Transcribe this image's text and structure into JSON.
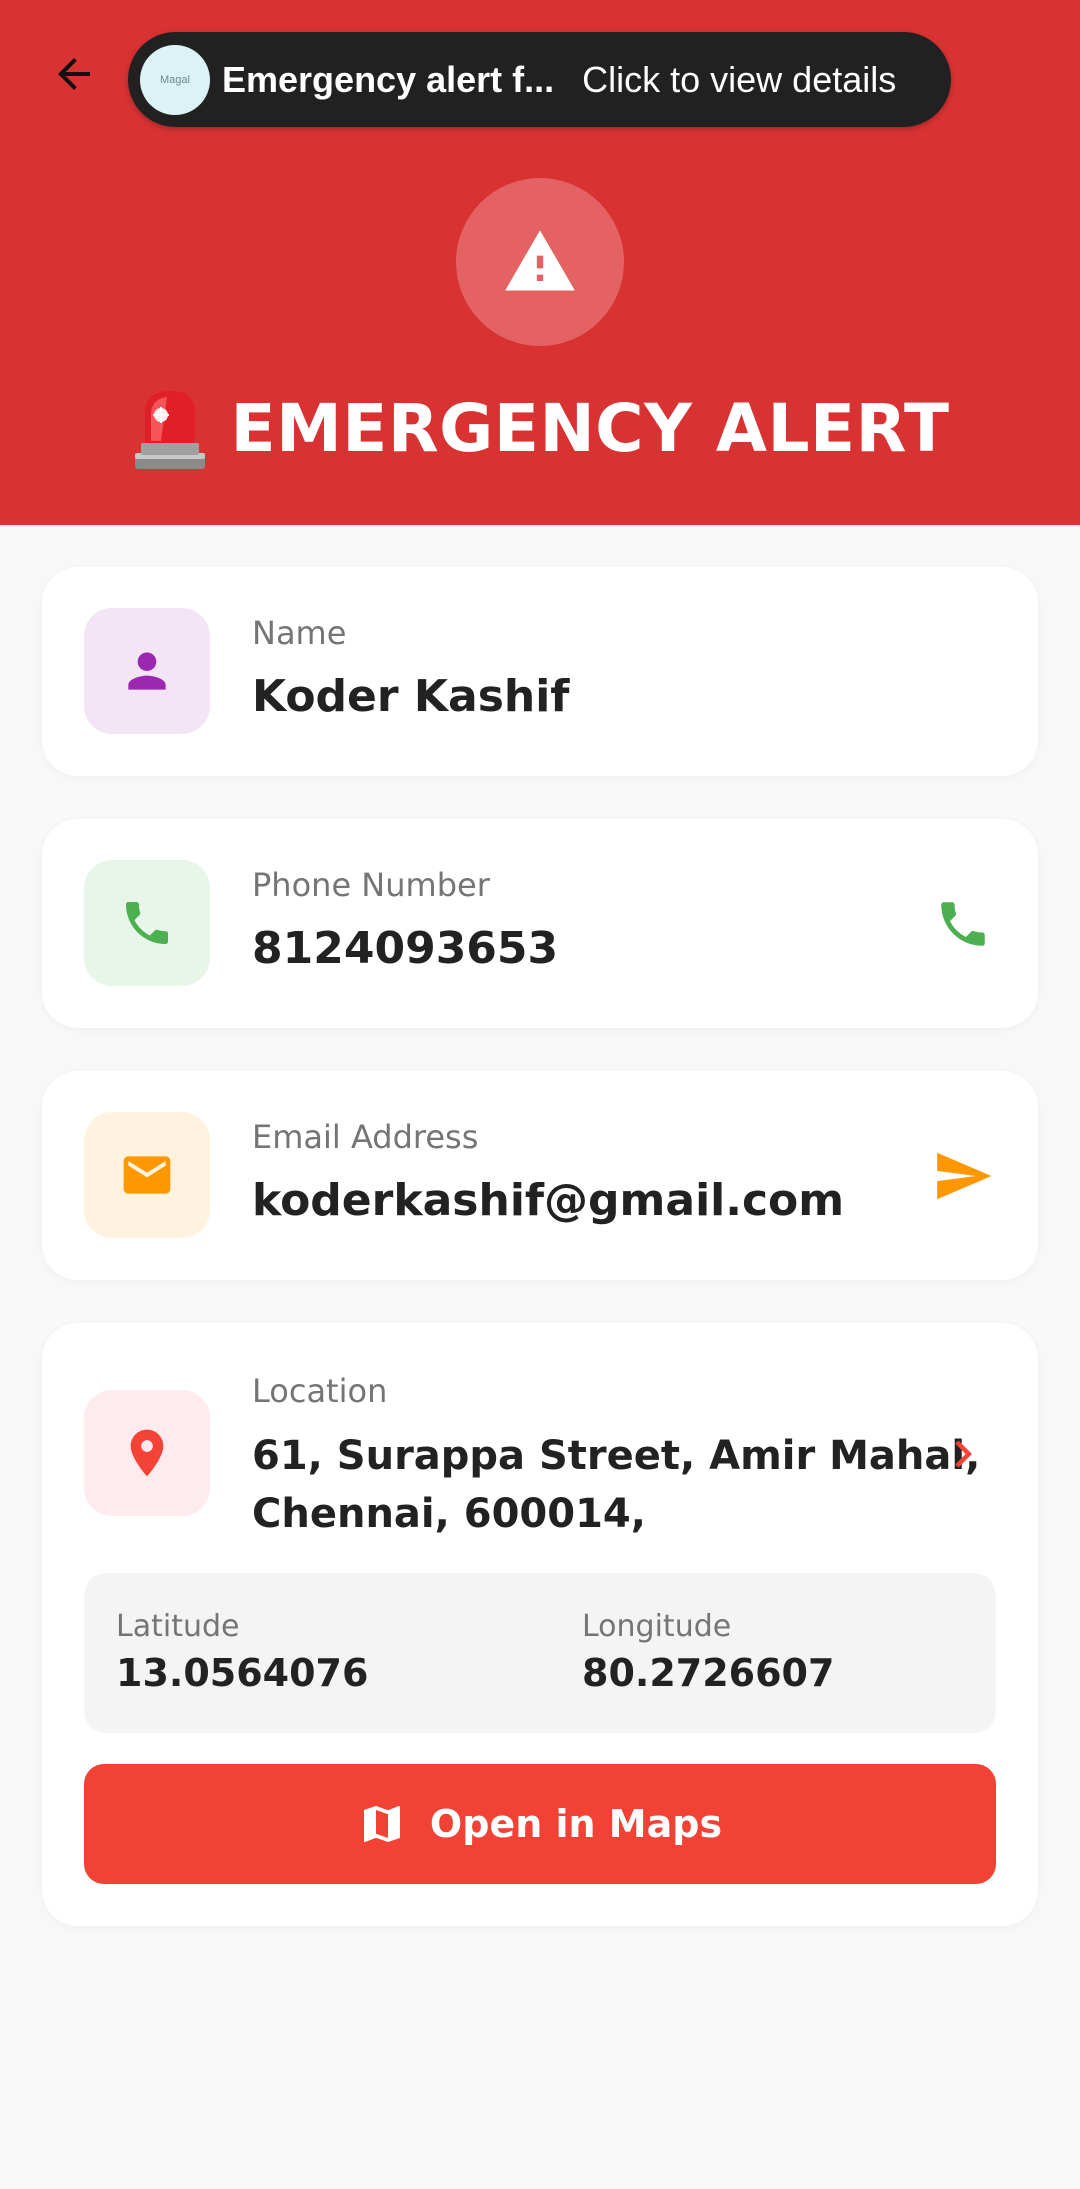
{
  "notification": {
    "avatar_text": "Magal",
    "title": "Emergency alert f...",
    "subtitle": "Click to view details"
  },
  "header": {
    "title": "EMERGENCY ALERT",
    "background_color": "#d93233"
  },
  "name_card": {
    "label": "Name",
    "value": "Koder Kashif",
    "icon": "person-icon",
    "icon_color": "#9c27b0"
  },
  "phone_card": {
    "label": "Phone Number",
    "value": "8124093653",
    "icon": "phone-icon",
    "action_icon": "call-icon",
    "icon_color": "#4caf50"
  },
  "email_card": {
    "label": "Email Address",
    "value": "koderkashif@gmail.com",
    "icon": "mail-icon",
    "action_icon": "send-icon",
    "icon_color": "#ff9800"
  },
  "location_card": {
    "label": "Location",
    "address_line1": "61, Surappa Street, Amir Mahal,",
    "address_line2": "Chennai, 600014,",
    "icon": "location-pin-icon",
    "action_icon": "chevron-right-icon",
    "icon_color": "#f44336",
    "latitude_label": "Latitude",
    "latitude_value": "13.0564076",
    "longitude_label": "Longitude",
    "longitude_value": "80.2726607",
    "maps_button_label": "Open in Maps",
    "maps_button_color": "#f24236"
  }
}
